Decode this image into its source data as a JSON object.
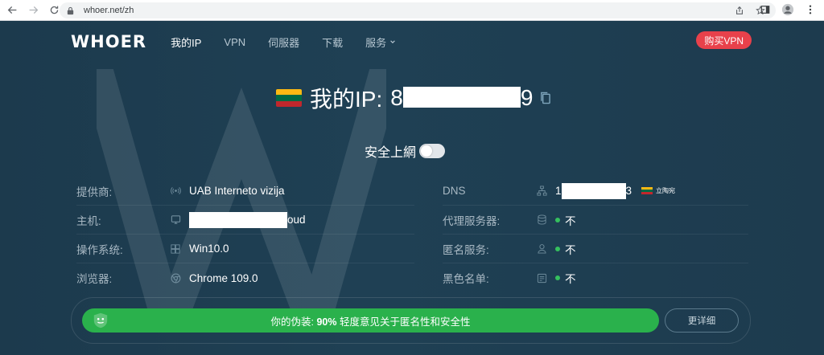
{
  "browser": {
    "url": "whoer.net/zh"
  },
  "header": {
    "logo": "WHOER",
    "nav": [
      "我的IP",
      "VPN",
      "伺服器",
      "下载",
      "服务"
    ],
    "buy_label": "购买VPN"
  },
  "ip": {
    "label": "我的IP:",
    "prefix": "8",
    "suffix": "9"
  },
  "safe": {
    "label": "安全上網"
  },
  "left_info": [
    {
      "key": "提供商:",
      "value": "UAB Interneto vizija",
      "icon": "signal-icon"
    },
    {
      "key": "主机:",
      "value": "oud",
      "icon": "monitor-icon"
    },
    {
      "key": "操作系统:",
      "value": "Win10.0",
      "icon": "windows-icon"
    },
    {
      "key": "浏览器:",
      "value": "Chrome 109.0",
      "icon": "chrome-icon"
    }
  ],
  "right_info": [
    {
      "key": "DNS",
      "value_prefix": "1",
      "value_suffix": "3",
      "country": "立陶宛",
      "icon": "network-icon"
    },
    {
      "key": "代理服务器:",
      "value": "不",
      "icon": "server-icon"
    },
    {
      "key": "匿名服务:",
      "value": "不",
      "icon": "user-icon"
    },
    {
      "key": "黑色名单:",
      "value": "不",
      "icon": "blacklist-icon"
    }
  ],
  "status": {
    "prefix": "你的伪装:",
    "percent": "90%",
    "suffix": "轻度意见关于匿名性和安全性",
    "details_label": "更详细"
  },
  "colors": {
    "background": "#1d3b4e",
    "accent_red": "#e8414b",
    "success_green": "#2ab14c",
    "dot_green": "#35c05e"
  }
}
